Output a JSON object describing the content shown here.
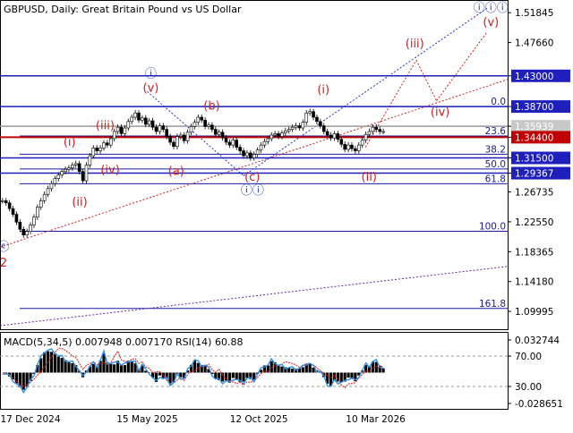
{
  "header": {
    "symbol_info": "GBPUSD, Daily:  Great Britain Pound vs US Dollar"
  },
  "colors": {
    "price_line": "#1f1fbd",
    "price_line_red": "#c00000",
    "fib_line": "#1a1aa0",
    "wave_red": "#d32020",
    "wave_blue": "#1a2fb0",
    "macd_hist": "#000000",
    "macd_signal": "#e02020",
    "rsi_line": "#2f8fe0",
    "trend_red_dotted": "#d32020",
    "trend_purple_dotted": "#6a2aa0",
    "trend_blue_dotted": "#2233dd"
  },
  "chart_data": [
    {
      "type": "line",
      "subtype": "candlestick",
      "title": "GBPUSD, Daily:  Great Britain Pound vs US Dollar",
      "ylim": [
        1.075,
        1.535
      ],
      "x_tick_labels": [
        "17 Dec 2024",
        "15 May 2025",
        "12 Oct 2025",
        "10 Mar 2026"
      ],
      "y_tick_labels": [
        "1.51845",
        "1.47660",
        "1.43000",
        "1.38700",
        "1.35939",
        "1.34400",
        "1.31500",
        "1.29367",
        "1.26735",
        "1.22550",
        "1.18365",
        "1.14180",
        "1.09995"
      ],
      "price_lines": [
        {
          "value": 1.43,
          "label": "1.43000",
          "style": "boxed"
        },
        {
          "value": 1.387,
          "label": "1.38700",
          "style": "boxed"
        },
        {
          "value": 1.35939,
          "label": "1.35939",
          "style": "boxed-gray"
        },
        {
          "value": 1.344,
          "label": "1.34400",
          "style": "boxed-red"
        },
        {
          "value": 1.315,
          "label": "1.31500",
          "style": "boxed"
        },
        {
          "value": 1.29367,
          "label": "1.29367",
          "style": "boxed"
        }
      ],
      "fibonacci_levels": [
        {
          "label": "0.0",
          "value": 1.387
        },
        {
          "label": "23.6",
          "value": 1.3457
        },
        {
          "label": "38.2",
          "value": 1.3202
        },
        {
          "label": "50.0",
          "value": 1.2995
        },
        {
          "label": "61.8",
          "value": 1.2789
        },
        {
          "label": "100.0",
          "value": 1.2122
        },
        {
          "label": "161.8",
          "value": 1.1041
        }
      ],
      "wave_labels": [
        {
          "text": "ⓒ",
          "color": "blue",
          "x": 0.0,
          "y": 1.185
        },
        {
          "text": "2",
          "color": "red",
          "x": 0.0,
          "y": 1.163
        },
        {
          "text": "(i)",
          "color": "red",
          "x": 0.13,
          "y": 1.332
        },
        {
          "text": "(ii)",
          "color": "red",
          "x": 0.15,
          "y": 1.248
        },
        {
          "text": "(iii)",
          "color": "red",
          "x": 0.2,
          "y": 1.355
        },
        {
          "text": "(iv)",
          "color": "red",
          "x": 0.21,
          "y": 1.293
        },
        {
          "text": "(v)",
          "color": "red",
          "x": 0.29,
          "y": 1.408
        },
        {
          "text": "ⓘ",
          "color": "blue",
          "x": 0.29,
          "y": 1.428
        },
        {
          "text": "(a)",
          "color": "red",
          "x": 0.34,
          "y": 1.291
        },
        {
          "text": "(b)",
          "color": "red",
          "x": 0.41,
          "y": 1.383
        },
        {
          "text": "(c)",
          "color": "red",
          "x": 0.49,
          "y": 1.283
        },
        {
          "text": "ⓘⓘ",
          "color": "blue",
          "x": 0.49,
          "y": 1.264
        },
        {
          "text": "(i)",
          "color": "red",
          "x": 0.63,
          "y": 1.405
        },
        {
          "text": "(ii)",
          "color": "red",
          "x": 0.72,
          "y": 1.283
        },
        {
          "text": "(iii)",
          "color": "red",
          "x": 0.81,
          "y": 1.47
        },
        {
          "text": "(iv)",
          "color": "red",
          "x": 0.86,
          "y": 1.374
        },
        {
          "text": "(v)",
          "color": "red",
          "x": 0.96,
          "y": 1.5
        },
        {
          "text": "ⓘⓘⓘ",
          "color": "blue",
          "x": 0.96,
          "y": 1.52
        }
      ],
      "candles_close": [
        1.255,
        1.252,
        1.244,
        1.236,
        1.225,
        1.215,
        1.207,
        1.212,
        1.221,
        1.232,
        1.246,
        1.255,
        1.264,
        1.272,
        1.279,
        1.286,
        1.291,
        1.296,
        1.299,
        1.301,
        1.305,
        1.307,
        1.296,
        1.283,
        1.305,
        1.318,
        1.329,
        1.325,
        1.329,
        1.336,
        1.333,
        1.342,
        1.352,
        1.358,
        1.349,
        1.357,
        1.366,
        1.372,
        1.378,
        1.368,
        1.371,
        1.362,
        1.367,
        1.358,
        1.352,
        1.36,
        1.355,
        1.345,
        1.337,
        1.331,
        1.345,
        1.347,
        1.339,
        1.351,
        1.359,
        1.365,
        1.372,
        1.368,
        1.359,
        1.361,
        1.355,
        1.348,
        1.351,
        1.343,
        1.337,
        1.333,
        1.34,
        1.33,
        1.325,
        1.318,
        1.322,
        1.315,
        1.32,
        1.326,
        1.333,
        1.338,
        1.342,
        1.347,
        1.349,
        1.345,
        1.35,
        1.353,
        1.355,
        1.358,
        1.36,
        1.357,
        1.365,
        1.378,
        1.38,
        1.372,
        1.366,
        1.36,
        1.352,
        1.347,
        1.343,
        1.349,
        1.341,
        1.334,
        1.327,
        1.333,
        1.328,
        1.325,
        1.333,
        1.34,
        1.348,
        1.352,
        1.358,
        1.355,
        1.352,
        1.352
      ],
      "macd": {
        "label": "MACD(5,34,5) 0.007948 0.007170 RSI(14) 60.88",
        "params": "5,34,5",
        "value": 0.007948,
        "signal": 0.00717,
        "rsi_period": 14,
        "rsi_value": 60.88,
        "y_tick_labels": [
          "0.032744",
          "70.00",
          "30.00",
          "-0.028651"
        ]
      }
    }
  ]
}
